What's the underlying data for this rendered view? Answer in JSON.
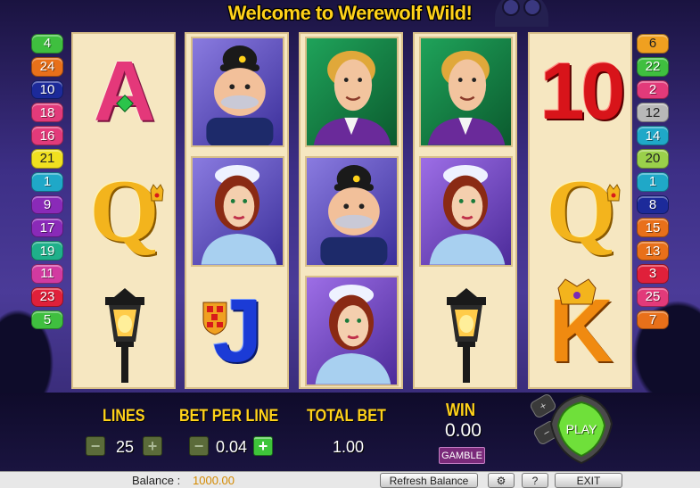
{
  "game": {
    "title": "Welcome to Werewolf Wild!"
  },
  "left_badges": [
    {
      "label": "4",
      "color": "#3fbf3f",
      "light": false
    },
    {
      "label": "24",
      "color": "#e8701a",
      "light": false
    },
    {
      "label": "10",
      "color": "#1c2a9a",
      "light": false
    },
    {
      "label": "18",
      "color": "#e23a7a",
      "light": false
    },
    {
      "label": "16",
      "color": "#e23a7a",
      "light": false
    },
    {
      "label": "21",
      "color": "#f0e020",
      "light": true
    },
    {
      "label": "1",
      "color": "#1fa8c8",
      "light": false
    },
    {
      "label": "9",
      "color": "#8a2ab8",
      "light": false
    },
    {
      "label": "17",
      "color": "#8a2ab8",
      "light": false
    },
    {
      "label": "19",
      "color": "#1fb08a",
      "light": false
    },
    {
      "label": "11",
      "color": "#d23aa0",
      "light": false
    },
    {
      "label": "23",
      "color": "#e0203a",
      "light": false
    },
    {
      "label": "5",
      "color": "#3fbf3f",
      "light": false
    }
  ],
  "right_badges": [
    {
      "label": "6",
      "color": "#f0a020",
      "light": true
    },
    {
      "label": "22",
      "color": "#3fbf3f",
      "light": false
    },
    {
      "label": "2",
      "color": "#e23a7a",
      "light": false
    },
    {
      "label": "12",
      "color": "#b8b8b8",
      "light": true
    },
    {
      "label": "14",
      "color": "#1fa8c8",
      "light": false
    },
    {
      "label": "20",
      "color": "#9ad04a",
      "light": true
    },
    {
      "label": "1",
      "color": "#1fa8c8",
      "light": false
    },
    {
      "label": "8",
      "color": "#1c2a9a",
      "light": false
    },
    {
      "label": "15",
      "color": "#e8701a",
      "light": false
    },
    {
      "label": "13",
      "color": "#e8701a",
      "light": false
    },
    {
      "label": "3",
      "color": "#e0203a",
      "light": false
    },
    {
      "label": "25",
      "color": "#e23a7a",
      "light": false
    },
    {
      "label": "7",
      "color": "#e8701a",
      "light": false
    }
  ],
  "reels": [
    [
      "A",
      "Q",
      "lamp"
    ],
    [
      "policeman",
      "maid",
      "J"
    ],
    [
      "gentleman",
      "policeman",
      "maid"
    ],
    [
      "gentleman",
      "maid",
      "lamp"
    ],
    [
      "10",
      "Q",
      "K"
    ]
  ],
  "symbols": {
    "A": "A",
    "Q": "Q",
    "J": "J",
    "K": "K",
    "ten": "10"
  },
  "controls": {
    "lines_label": "LINES",
    "lines_value": "25",
    "bet_label": "BET PER LINE",
    "bet_value": "0.04",
    "total_label": "TOTAL BET",
    "total_value": "1.00",
    "win_label": "WIN",
    "win_value": "0.00",
    "gamble_label": "GAMBLE",
    "play_label": "PLAY",
    "minus": "−",
    "plus": "+"
  },
  "footer": {
    "balance_label": "Balance :",
    "balance_value": "1000.00",
    "refresh_label": "Refresh Balance",
    "settings_icon": "⚙",
    "help_label": "?",
    "exit_label": "EXIT"
  },
  "colors": {
    "accent_yellow": "#ffd21a",
    "reel_bg": "#f6e7c1",
    "play_green": "#6fe03a"
  }
}
